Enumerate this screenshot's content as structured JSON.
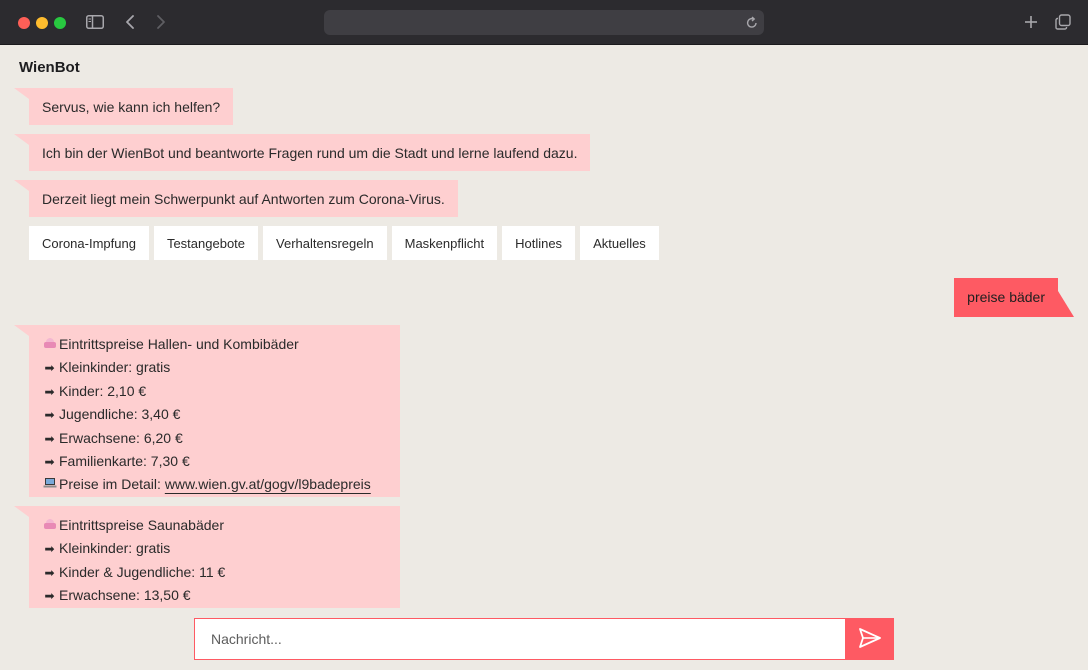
{
  "browser": {
    "url": ""
  },
  "app": {
    "title": "WienBot"
  },
  "messages": {
    "greeting": "Servus, wie kann ich helfen?",
    "intro": "Ich bin der WienBot und beantworte Fragen rund um die Stadt und lerne laufend dazu.",
    "focus": "Derzeit liegt mein Schwerpunkt auf Antworten zum Corona-Virus."
  },
  "chips": [
    "Corona-Impfung",
    "Testangebote",
    "Verhaltensregeln",
    "Maskenpflicht",
    "Hotlines",
    "Aktuelles"
  ],
  "user_message": "preise bäder",
  "prices_pools": {
    "title": "Eintrittspreise Hallen- und Kombibäder",
    "lines": [
      "Kleinkinder: gratis",
      "Kinder: 2,10 €",
      "Jugendliche: 3,40 €",
      "Erwachsene: 6,20 €",
      "Familienkarte: 7,30 €"
    ],
    "detail_label": "Preise im Detail:",
    "detail_link": "www.wien.gv.at/gogv/l9badepreis"
  },
  "prices_sauna": {
    "title": "Eintrittspreise Saunabäder",
    "lines": [
      "Kleinkinder: gratis",
      "Kinder & Jugendliche: 11 €",
      "Erwachsene: 13,50 €"
    ]
  },
  "composer": {
    "placeholder": "Nachricht..."
  },
  "icons": {
    "arrow": "➡",
    "pool": "swimming-icon",
    "laptop": "laptop-icon"
  },
  "colors": {
    "bot_bubble": "#fecfd0",
    "user_bubble": "#fe5a63",
    "background": "#edeae4"
  }
}
